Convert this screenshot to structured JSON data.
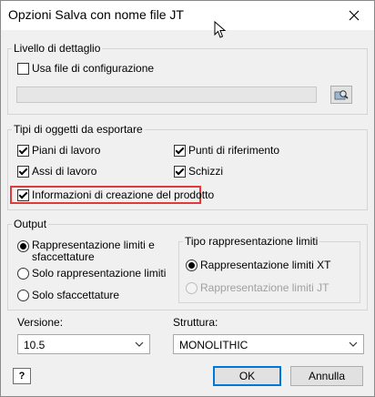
{
  "window": {
    "title": "Opzioni Salva con nome file JT"
  },
  "detail_group": {
    "legend": "Livello di dettaglio",
    "use_config_label": "Usa file di configurazione",
    "use_config_checked": false,
    "config_path_value": ""
  },
  "types_group": {
    "legend": "Tipi di oggetti da esportare",
    "items": [
      {
        "label": "Piani di lavoro",
        "checked": true
      },
      {
        "label": "Punti di riferimento",
        "checked": true
      },
      {
        "label": "Assi di lavoro",
        "checked": true
      },
      {
        "label": "Schizzi",
        "checked": true
      },
      {
        "label": "Informazioni di creazione del prodotto",
        "checked": true
      }
    ]
  },
  "output_group": {
    "legend": "Output",
    "options": [
      {
        "label_line1": "Rappresentazione limiti e",
        "label_line2": "sfaccettature",
        "selected": true
      },
      {
        "label": "Solo rappresentazione limiti",
        "selected": false
      },
      {
        "label": "Solo sfaccettature",
        "selected": false
      }
    ]
  },
  "boundary_group": {
    "legend": "Tipo rappresentazione limiti",
    "options": [
      {
        "label": "Rappresentazione limiti XT",
        "selected": true,
        "enabled": true
      },
      {
        "label": "Rappresentazione limiti JT",
        "selected": false,
        "enabled": false
      }
    ]
  },
  "version": {
    "label": "Versione:",
    "value": "10.5"
  },
  "structure": {
    "label": "Struttura:",
    "value": "MONOLITHIC"
  },
  "buttons": {
    "help": "?",
    "ok": "OK",
    "cancel": "Annulla"
  },
  "colors": {
    "highlight": "#e23a3a",
    "default_button_border": "#0078d7"
  }
}
